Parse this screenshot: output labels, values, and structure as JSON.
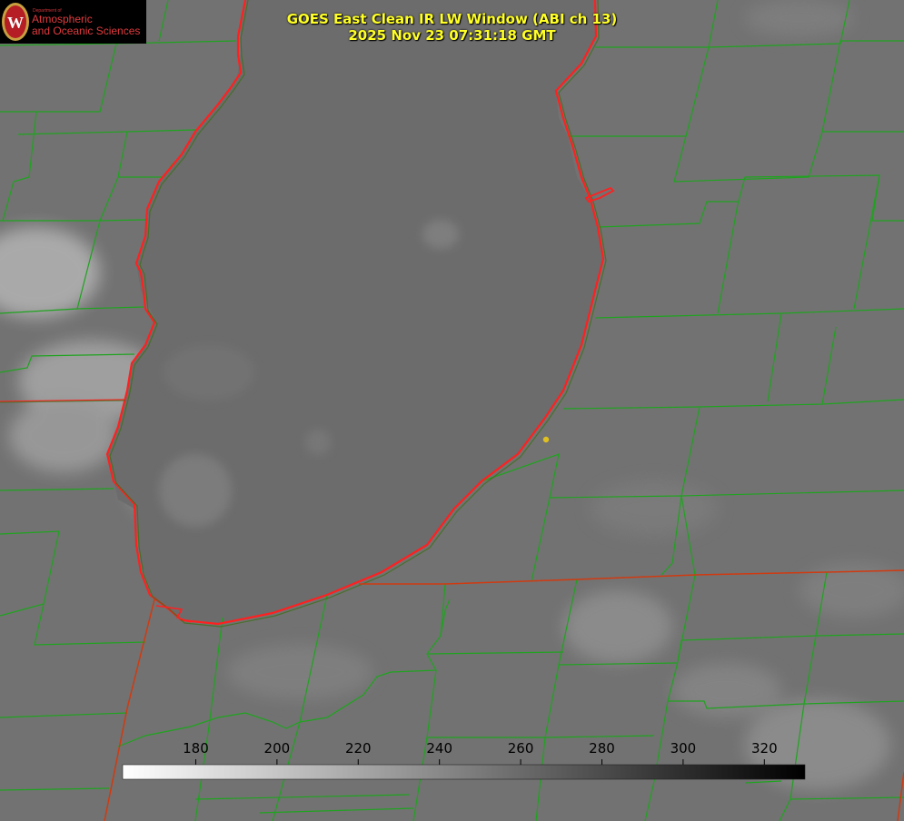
{
  "header": {
    "title_line1": "GOES East Clean IR LW Window (ABI ch 13)",
    "title_line2": "2025 Nov 23 07:31:18 GMT"
  },
  "logo": {
    "department": "Department of",
    "line1": "Atmospheric",
    "line2": "and Oceanic Sciences",
    "emblem_icon": "uw-crest-icon"
  },
  "colorbar": {
    "ticks": [
      180,
      200,
      220,
      240,
      260,
      280,
      300,
      320
    ],
    "range": [
      162,
      330
    ],
    "colormap": "white-to-black"
  },
  "colors": {
    "state_border": "#ff2020",
    "county_lines": "#1fa31f",
    "marker": "#e0c020",
    "title": "#ffff26"
  },
  "icons": {
    "station_marker": "yellow-dot-icon"
  }
}
